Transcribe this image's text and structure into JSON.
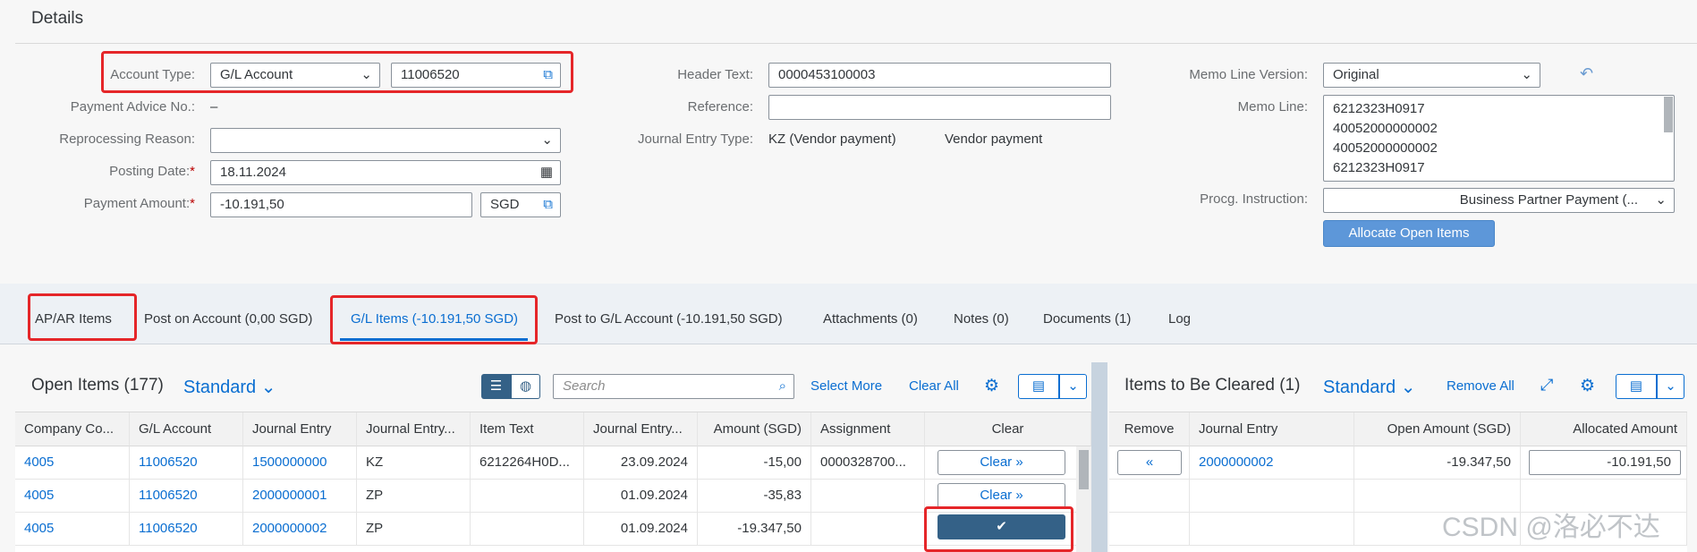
{
  "header": {
    "title": "Details"
  },
  "form": {
    "account_type_label": "Account Type:",
    "account_type_value": "G/L Account",
    "account_value": "11006520",
    "payment_advice_label": "Payment Advice No.:",
    "payment_advice_value": "–",
    "reprocessing_label": "Reprocessing Reason:",
    "reprocessing_value": "",
    "posting_date_label": "Posting Date:",
    "posting_date_value": "18.11.2024",
    "payment_amount_label": "Payment Amount:",
    "payment_amount_value": "-10.191,50",
    "currency_value": "SGD",
    "required_mark": "*",
    "header_text_label": "Header Text:",
    "header_text_value": "0000453100003",
    "reference_label": "Reference:",
    "reference_value": "",
    "je_type_label": "Journal Entry Type:",
    "je_type_value": "KZ (Vendor payment)",
    "je_type_desc": "Vendor payment",
    "memo_version_label": "Memo Line Version:",
    "memo_version_value": "Original",
    "memo_line_label": "Memo Line:",
    "memo_lines": [
      "6212323H0917",
      "40052000000002",
      "40052000000002",
      "6212323H0917"
    ],
    "procg_label": "Procg. Instruction:",
    "procg_value": "Business Partner Payment (...",
    "allocate_label": "Allocate Open Items"
  },
  "tabs": [
    {
      "label": "AP/AR Items"
    },
    {
      "label": "Post on Account (0,00 SGD)"
    },
    {
      "label": "G/L Items (-10.191,50 SGD)"
    },
    {
      "label": "Post to G/L Account (-10.191,50 SGD)"
    },
    {
      "label": "Attachments (0)"
    },
    {
      "label": "Notes (0)"
    },
    {
      "label": "Documents (1)"
    },
    {
      "label": "Log"
    }
  ],
  "open_items": {
    "title": "Open Items (177)",
    "variant": "Standard",
    "search_placeholder": "Search",
    "select_more": "Select More",
    "clear_all": "Clear All",
    "columns": [
      "Company Co...",
      "G/L Account",
      "Journal Entry",
      "Journal Entry...",
      "Item Text",
      "Journal Entry...",
      "Amount (SGD)",
      "Assignment",
      "Clear"
    ],
    "rows": [
      {
        "company": "4005",
        "gl": "11006520",
        "je": "1500000000",
        "jetype": "KZ",
        "text": "6212264H0D...",
        "date": "23.09.2024",
        "amount": "-15,00",
        "assignment": "0000328700...",
        "clear": "Clear"
      },
      {
        "company": "4005",
        "gl": "11006520",
        "je": "2000000001",
        "jetype": "ZP",
        "text": "",
        "date": "01.09.2024",
        "amount": "-35,83",
        "assignment": "",
        "clear": "Clear"
      },
      {
        "company": "4005",
        "gl": "11006520",
        "je": "2000000002",
        "jetype": "ZP",
        "text": "",
        "date": "01.09.2024",
        "amount": "-19.347,50",
        "assignment": "",
        "clear": ""
      }
    ]
  },
  "cleared": {
    "title": "Items to Be Cleared (1)",
    "variant": "Standard",
    "remove_all": "Remove All",
    "columns": [
      "Remove",
      "Journal Entry",
      "Open Amount (SGD)",
      "Allocated Amount"
    ],
    "rows": [
      {
        "je": "2000000002",
        "open": "-19.347,50",
        "allocated": "-10.191,50"
      }
    ]
  },
  "watermark": "CSDN @洛必不达",
  "colors": {
    "accent": "#0a6ed1",
    "highlight": "#e52629",
    "selected_button": "#346187"
  }
}
